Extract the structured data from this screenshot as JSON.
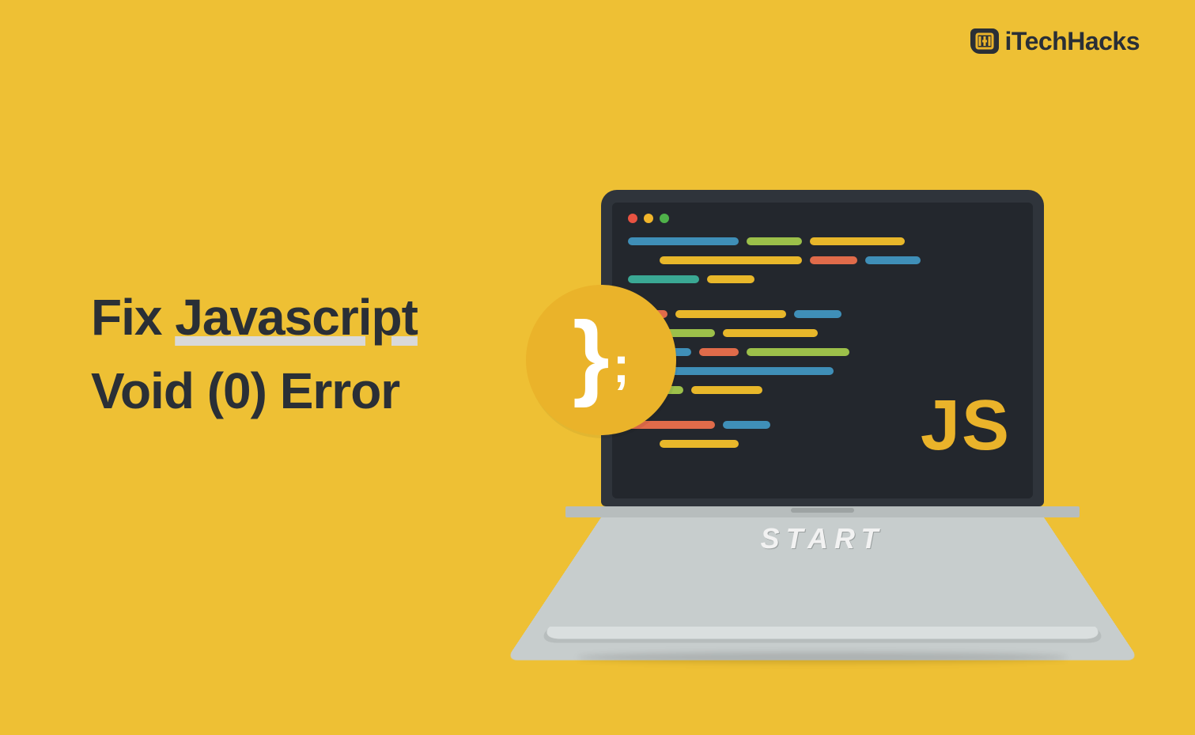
{
  "brand": {
    "name": "iTechHacks"
  },
  "headline": {
    "line1_prefix": "Fix ",
    "line1_underlined": "Javascript",
    "line2": "Void (0) Error"
  },
  "laptop": {
    "js_label": "JS",
    "keyboard_label": "START"
  },
  "badge": {
    "brace": "}",
    "semicolon": ";"
  },
  "colors": {
    "page_bg": "#eec034",
    "dark": "#2a2f36",
    "accent_yellow": "#eab32a"
  }
}
